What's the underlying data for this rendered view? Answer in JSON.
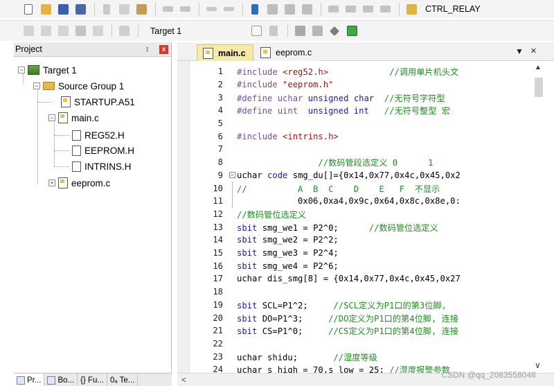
{
  "toolbar1": {
    "config_label": "CTRL_RELAY"
  },
  "toolbar2": {
    "target_select": "Target 1"
  },
  "project_panel": {
    "title": "Project",
    "pin_glyph": "↕",
    "close_glyph": "x",
    "tree": {
      "target": "Target 1",
      "group": "Source Group 1",
      "files": [
        "STARTUP.A51",
        "main.c",
        "REG52.H",
        "EEPROM.H",
        "INTRINS.H",
        "eeprom.c"
      ]
    }
  },
  "panel_tabs": [
    "Pr...",
    "Bo...",
    "{} Fu...",
    "0ₐ Te..."
  ],
  "editor": {
    "tabs": [
      "main.c",
      "eeprom.c"
    ],
    "lines": [
      {
        "n": "1",
        "fold": "",
        "segs": [
          [
            "pp",
            "#include "
          ],
          [
            "str",
            "<reg52.h>"
          ],
          [
            "cm",
            "            //调用单片机头文"
          ]
        ]
      },
      {
        "n": "2",
        "fold": "",
        "segs": [
          [
            "pp",
            "#include "
          ],
          [
            "str",
            "\"eeprom.h\""
          ]
        ]
      },
      {
        "n": "3",
        "fold": "",
        "segs": [
          [
            "pp",
            "#define uchar "
          ],
          [
            "kw",
            "unsigned char"
          ],
          [
            "cm",
            "  //无符号字符型"
          ]
        ]
      },
      {
        "n": "4",
        "fold": "",
        "segs": [
          [
            "pp",
            "#define uint  "
          ],
          [
            "kw",
            "unsigned int"
          ],
          [
            "cm",
            "   //无符号整型 宏"
          ]
        ]
      },
      {
        "n": "5",
        "fold": "",
        "segs": []
      },
      {
        "n": "6",
        "fold": "",
        "segs": [
          [
            "pp",
            "#include "
          ],
          [
            "str",
            "<intrins.h>"
          ]
        ]
      },
      {
        "n": "7",
        "fold": "",
        "segs": []
      },
      {
        "n": "8",
        "fold": "",
        "segs": [
          [
            "cm",
            "                //数码管段选定义 0      1"
          ]
        ]
      },
      {
        "n": "9",
        "fold": "box",
        "segs": [
          [
            "pl",
            "uchar "
          ],
          [
            "kw",
            "code"
          ],
          [
            "pl",
            " smg_du[]={0x14,0x77,0x4c,0x45,0x2"
          ]
        ]
      },
      {
        "n": "10",
        "fold": "guide",
        "segs": [
          [
            "cm",
            "//          A  B  C    D    E   F  不显示"
          ]
        ]
      },
      {
        "n": "11",
        "fold": "guide",
        "segs": [
          [
            "pl",
            "            0x06,0xa4,0x9c,0x64,0x8c,0x8e,0:"
          ]
        ]
      },
      {
        "n": "12",
        "fold": "",
        "segs": [
          [
            "cm",
            "//数码管位选定义"
          ]
        ]
      },
      {
        "n": "13",
        "fold": "",
        "segs": [
          [
            "kw",
            "sbit"
          ],
          [
            "pl",
            " smg_we1 = P2^0;      "
          ],
          [
            "cm",
            "//数码管位选定义"
          ]
        ]
      },
      {
        "n": "14",
        "fold": "",
        "segs": [
          [
            "kw",
            "sbit"
          ],
          [
            "pl",
            " smg_we2 = P2^2;"
          ]
        ]
      },
      {
        "n": "15",
        "fold": "",
        "segs": [
          [
            "kw",
            "sbit"
          ],
          [
            "pl",
            " smg_we3 = P2^4;"
          ]
        ]
      },
      {
        "n": "16",
        "fold": "",
        "segs": [
          [
            "kw",
            "sbit"
          ],
          [
            "pl",
            " smg_we4 = P2^6;"
          ]
        ]
      },
      {
        "n": "17",
        "fold": "",
        "segs": [
          [
            "pl",
            "uchar dis_smg[8] = {0x14,0x77,0x4c,0x45,0x27"
          ]
        ]
      },
      {
        "n": "18",
        "fold": "",
        "segs": []
      },
      {
        "n": "19",
        "fold": "",
        "segs": [
          [
            "kw",
            "sbit"
          ],
          [
            "pl",
            " SCL=P1^2;     "
          ],
          [
            "cm",
            "//SCL定义为P1口的第3位脚, "
          ]
        ]
      },
      {
        "n": "20",
        "fold": "",
        "segs": [
          [
            "kw",
            "sbit"
          ],
          [
            "pl",
            " DO=P1^3;     "
          ],
          [
            "cm",
            "//DO定义为P1口的第4位脚, 连接"
          ]
        ]
      },
      {
        "n": "21",
        "fold": "",
        "segs": [
          [
            "kw",
            "sbit"
          ],
          [
            "pl",
            " CS=P1^0;     "
          ],
          [
            "cm",
            "//CS定义为P1口的第4位脚, 连接"
          ]
        ]
      },
      {
        "n": "22",
        "fold": "",
        "segs": []
      },
      {
        "n": "23",
        "fold": "",
        "segs": [
          [
            "pl",
            "uchar shidu;       "
          ],
          [
            "cm",
            "//湿度等级"
          ]
        ]
      },
      {
        "n": "24",
        "fold": "",
        "segs": [
          [
            "pl",
            "uchar s_high = 70,s_low = 25; "
          ],
          [
            "cm",
            "//湿度报警参数"
          ]
        ]
      }
    ]
  },
  "scrollbar": {
    "up": "▲",
    "down": "∨",
    "left": "<"
  },
  "tab_menu_glyph": "▼",
  "tab_close_glyph": "×",
  "watermark": "CSDN @qq_2083558048",
  "colors": {
    "keyword": "#1a1aa6",
    "preprocessor": "#7a4a9a",
    "string": "#a31515",
    "comment": "#238a23",
    "active_tab": "#f7e9a8"
  }
}
